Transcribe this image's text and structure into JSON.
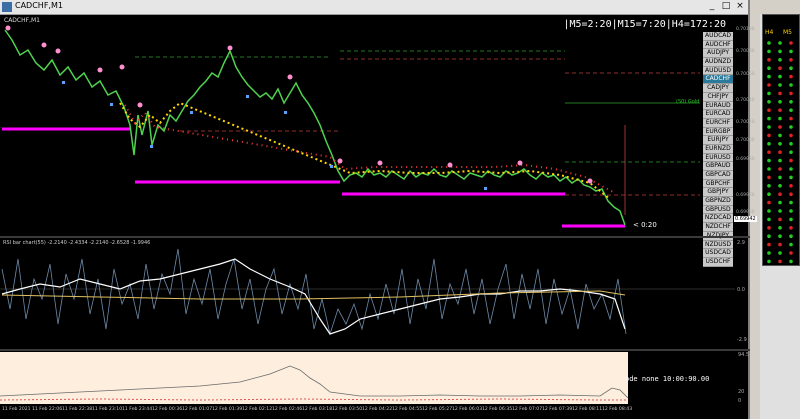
{
  "window": {
    "title": "CADCHF,M1",
    "minimize": "_",
    "maximize": "□",
    "close": "×"
  },
  "chart": {
    "label": "CADCHF,M1",
    "tf_info": "|M5=2:20|M15=7:20|H4=172:20",
    "countdown": "< 0:20",
    "last_price": "0.69942",
    "price_levels": [
      "0.70100",
      "0.70080",
      "0.70060",
      "0.70040",
      "0.70020",
      "0.70000",
      "0.69980",
      "0.69960",
      "0.69950"
    ],
    "pivot_label": "(S0) Gold"
  },
  "symbols": [
    "AUDCAD",
    "AUDCHF",
    "AUDJPY",
    "AUDNZD",
    "AUDUSD",
    "CADCHF",
    "CADJPY",
    "CHFJPY",
    "EURAUD",
    "EURCAD",
    "EURCHF",
    "EURGBP",
    "EURJPY",
    "EURNZD",
    "EURUSD",
    "GBPAUD",
    "GBPCAD",
    "GBPCHF",
    "GBPJPY",
    "GBPNZD",
    "GBPUSD",
    "NZDCAD",
    "NZDCHF",
    "NZDJPY",
    "NZDUSD",
    "USDCAD",
    "USDCHF"
  ],
  "active_symbol": "CADCHF",
  "rsi": {
    "label": "RSI bar chart(55) -2.2140 -2.4334 -2.2140 -2.6528 -1.9946",
    "scale_top": "2.9",
    "scale_mid": "0.0",
    "scale_bot": "-2.9"
  },
  "panel3": {
    "mode_text": "ode none 10:00:90.00",
    "scale_top": "94.5",
    "scale_mid": "20",
    "scale_bot": "0"
  },
  "time_axis": [
    "11 Feb 2021",
    "11 Feb 22:06",
    "11 Feb 22:38",
    "11 Feb 23:10",
    "11 Feb 23:44",
    "12 Feb 00:36",
    "12 Feb 01:07",
    "12 Feb 01:39",
    "12 Feb 02:12",
    "12 Feb 02:46",
    "12 Feb 03:18",
    "12 Feb 03:50",
    "12 Feb 04:22",
    "12 Feb 04:55",
    "12 Feb 05:27",
    "12 Feb 06:03",
    "12 Feb 06:35",
    "12 Feb 07:07",
    "12 Feb 07:39",
    "12 Feb 08:11",
    "12 Feb 08:43"
  ],
  "dashboard": {
    "headers": [
      "H4",
      "M5"
    ],
    "colors": {
      "green": "#22cc22",
      "red": "#dd2222",
      "yellow": "#ffd500",
      "magenta": "#ff00ff"
    }
  }
}
